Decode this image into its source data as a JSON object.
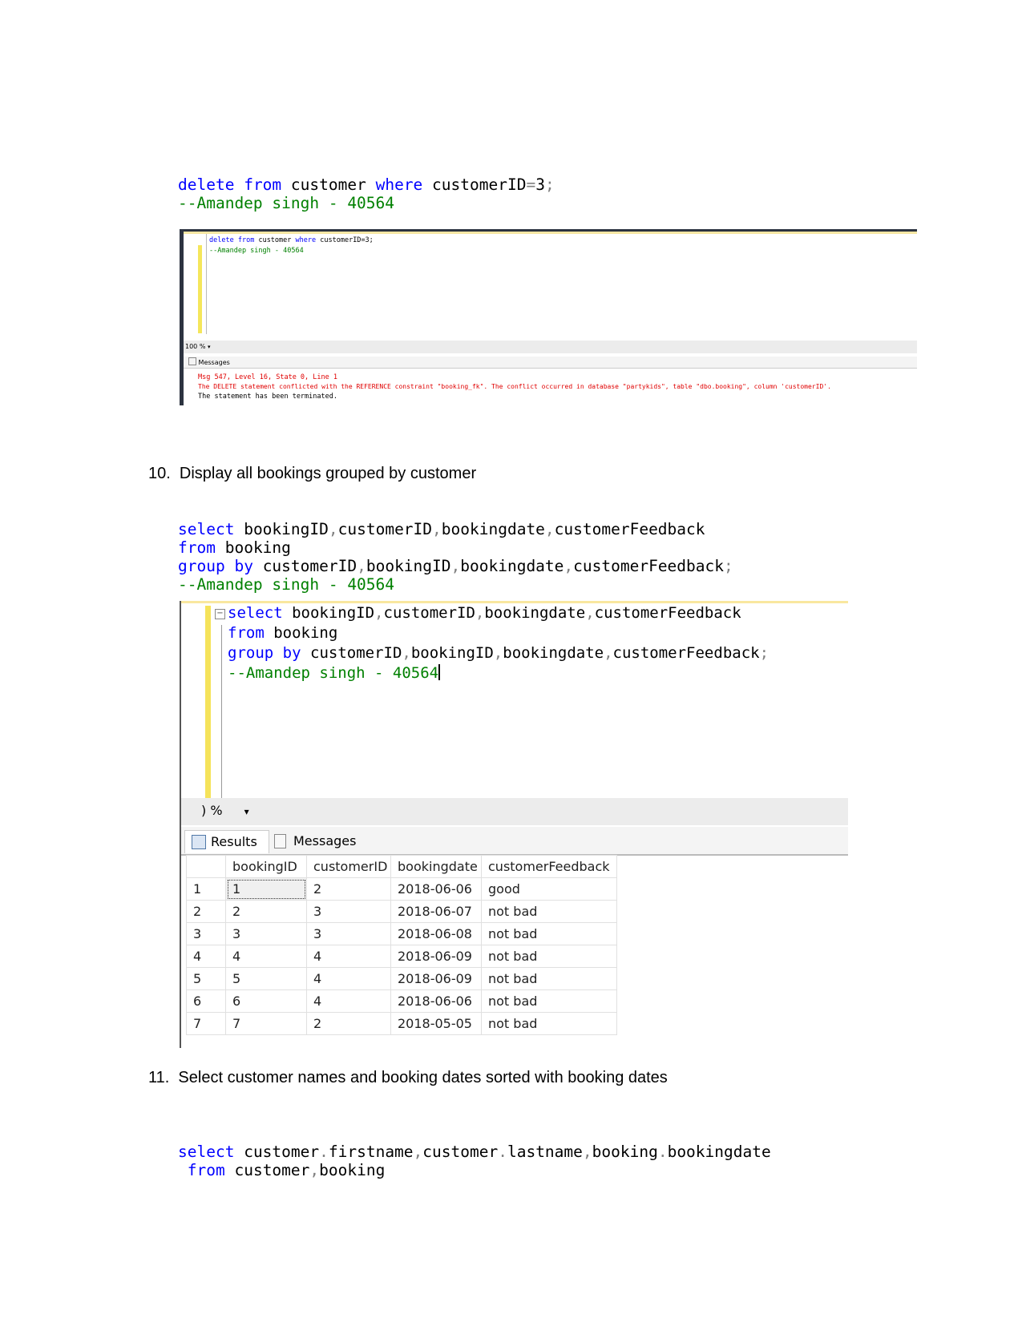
{
  "section9": {
    "code": {
      "line1": {
        "kw1": "delete",
        "kw2": "from",
        "t1": "customer",
        "kw3": "where",
        "t2": "customerID",
        "op1": "=",
        "t3": "3",
        "op2": ";"
      },
      "comment": "--Amandep singh - 40564"
    },
    "screenshot": {
      "code_line1": {
        "kw1": "delete",
        "kw2": "from",
        "t1": "customer",
        "kw3": "where",
        "t2": "customerID",
        "t3": "=3;"
      },
      "comment": "--Amandep singh - 40564",
      "zoom": "100 %",
      "messages_tab": "Messages",
      "msg1": "Msg 547, Level 16, State 0, Line 1",
      "msg2": "The DELETE statement conflicted with the REFERENCE constraint \"booking_fk\". The conflict occurred in database \"partykids\", table \"dbo.booking\", column 'customerID'.",
      "msg3": "The statement has been terminated."
    }
  },
  "section10": {
    "heading": "10.  Display all bookings grouped by customer",
    "code": {
      "l1_kw": "select",
      "l1_a": "bookingID",
      "l1_b": "customerID",
      "l1_c": "bookingdate",
      "l1_d": "customerFeedback",
      "l2_kw": "from",
      "l2_a": "booking",
      "l3_kw1": "group",
      "l3_kw2": "by",
      "l3_a": "customerID",
      "l3_b": "bookingID",
      "l3_c": "bookingdate",
      "l3_d": "customerFeedback",
      "comma": ",",
      "semi": ";",
      "comment": "--Amandep singh - 40564"
    },
    "screenshot": {
      "collapse_glyph": "−",
      "zoom": ") %",
      "tabs": {
        "results": "Results",
        "messages": "Messages"
      },
      "columns": [
        "bookingID",
        "customerID",
        "bookingdate",
        "customerFeedback"
      ],
      "rows": [
        {
          "n": "1",
          "bookingID": "1",
          "customerID": "2",
          "bookingdate": "2018-06-06",
          "customerFeedback": "good"
        },
        {
          "n": "2",
          "bookingID": "2",
          "customerID": "3",
          "bookingdate": "2018-06-07",
          "customerFeedback": "not bad"
        },
        {
          "n": "3",
          "bookingID": "3",
          "customerID": "3",
          "bookingdate": "2018-06-08",
          "customerFeedback": "not bad"
        },
        {
          "n": "4",
          "bookingID": "4",
          "customerID": "4",
          "bookingdate": "2018-06-09",
          "customerFeedback": "not bad"
        },
        {
          "n": "5",
          "bookingID": "5",
          "customerID": "4",
          "bookingdate": "2018-06-09",
          "customerFeedback": "not bad"
        },
        {
          "n": "6",
          "bookingID": "6",
          "customerID": "4",
          "bookingdate": "2018-06-06",
          "customerFeedback": "not bad"
        },
        {
          "n": "7",
          "bookingID": "7",
          "customerID": "2",
          "bookingdate": "2018-05-05",
          "customerFeedback": "not bad"
        }
      ]
    }
  },
  "section11": {
    "heading": "11.  Select customer names and booking dates sorted with booking dates",
    "code": {
      "l1_kw": "select",
      "l1_a": "customer",
      "l1_b": "firstname",
      "l1_c": "customer",
      "l1_d": "lastname",
      "l1_e": "booking",
      "l1_f": "bookingdate",
      "l2_kw": "from",
      "l2_a": "customer",
      "l2_b": "booking",
      "dot": ".",
      "comma": ","
    }
  }
}
